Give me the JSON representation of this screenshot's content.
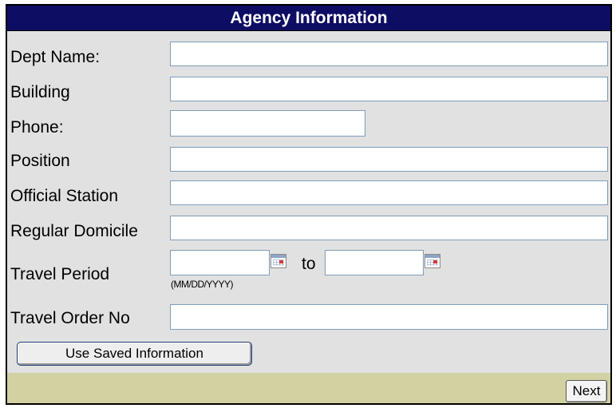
{
  "form": {
    "title": "Agency Information",
    "fields": {
      "dept_name": {
        "label": "Dept Name:",
        "value": ""
      },
      "building": {
        "label": "Building",
        "value": ""
      },
      "phone": {
        "label": "Phone:",
        "value": ""
      },
      "position": {
        "label": "Position",
        "value": ""
      },
      "official_station": {
        "label": "Official Station",
        "value": ""
      },
      "regular_domicile": {
        "label": "Regular Domicile",
        "value": ""
      },
      "travel_period": {
        "label": "Travel Period",
        "start_value": "",
        "separator": "to",
        "end_value": "",
        "format_hint": "(MM/DD/YYYY)",
        "icon": "calendar-icon"
      },
      "travel_order_no": {
        "label": "Travel Order No",
        "value": ""
      }
    },
    "buttons": {
      "use_saved": "Use Saved Information",
      "next": "Next"
    }
  },
  "colors": {
    "title_bar": "#0d0d63",
    "form_background": "#e1e1e1",
    "footer_background": "#d2d1a1"
  }
}
